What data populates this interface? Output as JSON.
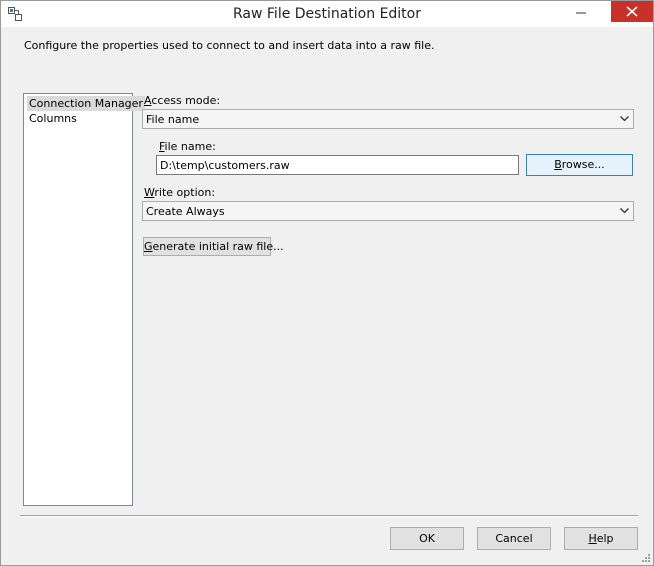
{
  "window": {
    "title": "Raw File Destination Editor"
  },
  "description": "Configure the properties used to connect to and insert data into a raw file.",
  "sidebar": {
    "items": [
      {
        "label": "Connection Manager",
        "selected": true
      },
      {
        "label": "Columns",
        "selected": false
      }
    ]
  },
  "access_mode": {
    "label_accel": "A",
    "label_rest": "ccess mode:",
    "value": "File name"
  },
  "file_name": {
    "label_accel": "F",
    "label_rest": "ile name:",
    "value": "D:\\temp\\customers.raw",
    "browse_accel": "B",
    "browse_rest": "rowse..."
  },
  "write_option": {
    "label_accel": "W",
    "label_rest": "rite option:",
    "value": "Create Always"
  },
  "generate": {
    "accel": "G",
    "rest": "enerate initial raw file..."
  },
  "footer": {
    "ok_label": "OK",
    "cancel_label": "Cancel",
    "help_accel": "H",
    "help_rest": "elp"
  },
  "colors": {
    "close_button": "#c7312a",
    "window_bg": "#f0f0f0"
  }
}
